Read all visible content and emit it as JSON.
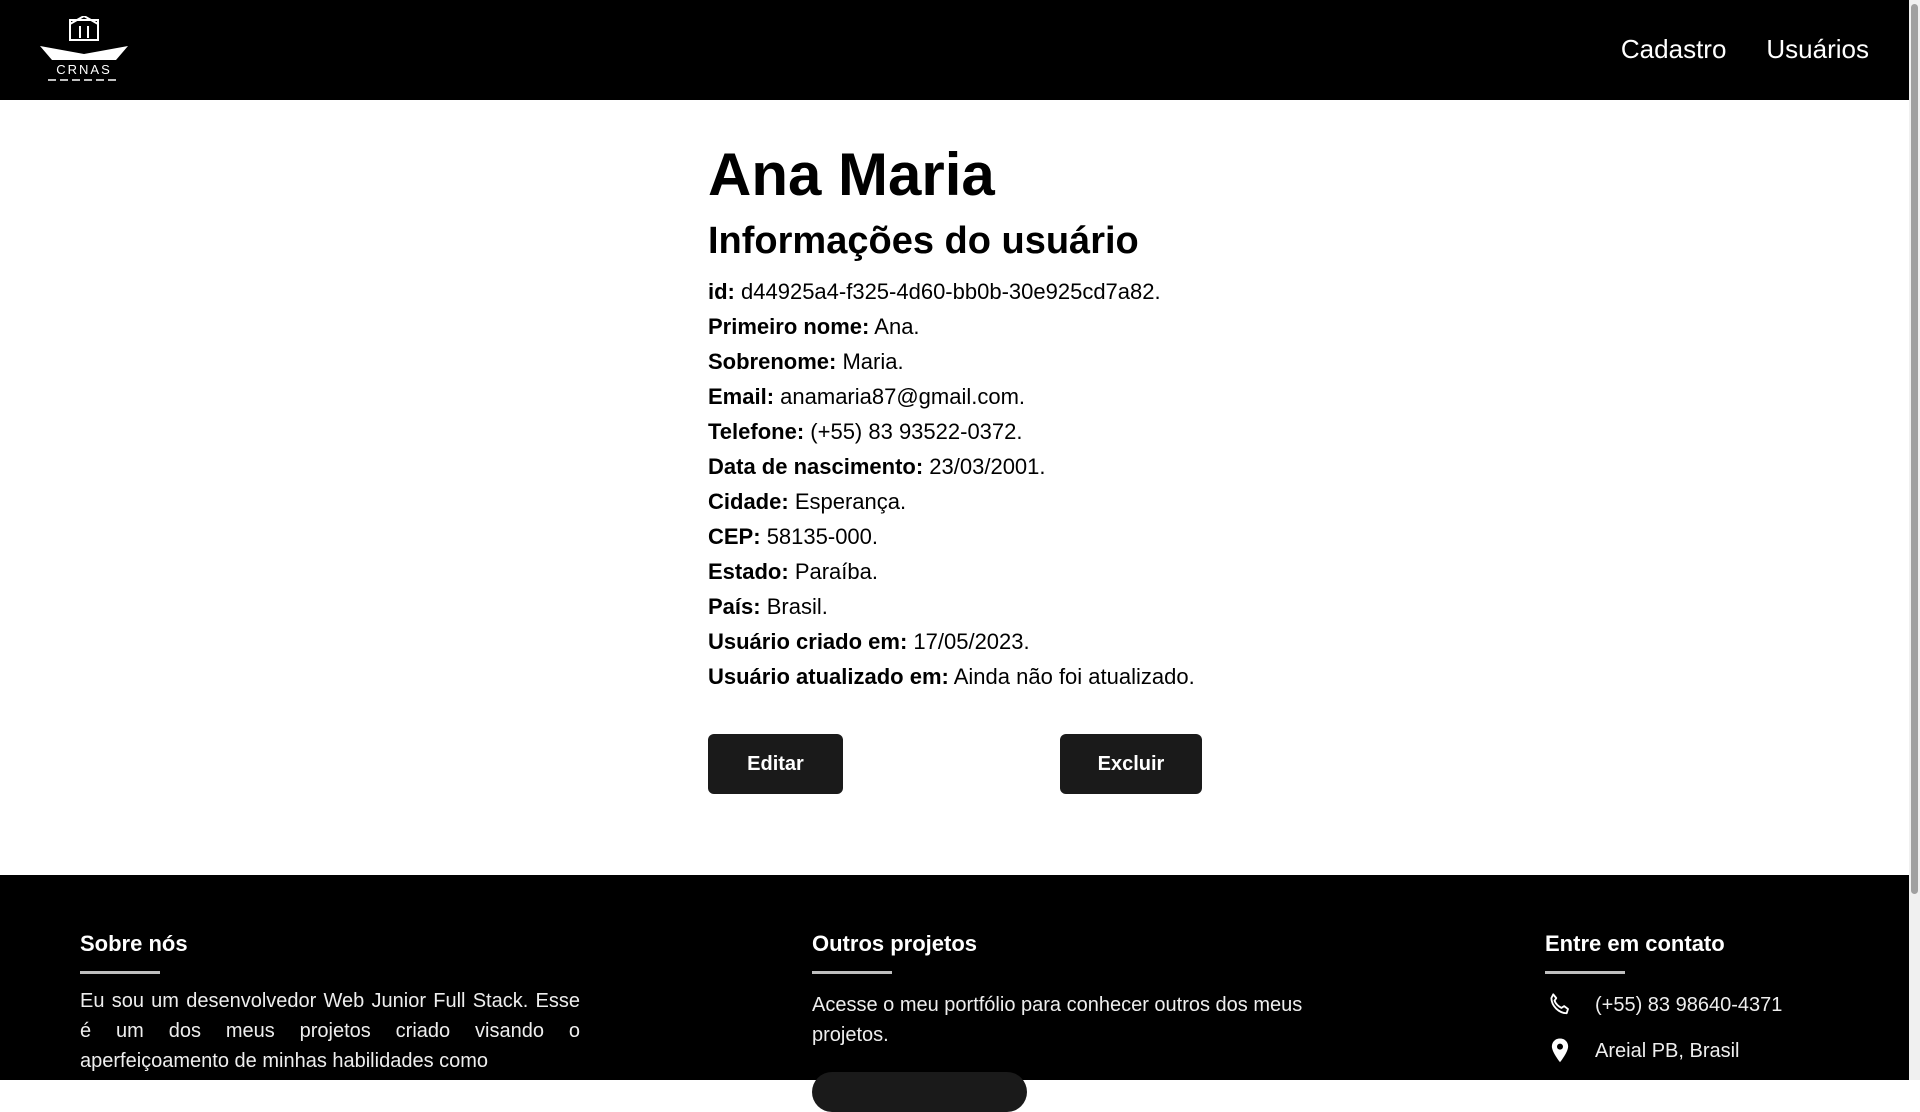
{
  "header": {
    "logo_text": "CRNAS",
    "nav": [
      {
        "label": "Cadastro"
      },
      {
        "label": "Usuários"
      }
    ]
  },
  "user": {
    "name": "Ana Maria",
    "section_title": "Informações do usuário",
    "fields": [
      {
        "label": "id:",
        "value": "d44925a4-f325-4d60-bb0b-30e925cd7a82."
      },
      {
        "label": "Primeiro nome:",
        "value": "Ana."
      },
      {
        "label": "Sobrenome:",
        "value": "Maria."
      },
      {
        "label": "Email:",
        "value": "anamaria87@gmail.com."
      },
      {
        "label": "Telefone:",
        "value": "(+55) 83 93522-0372."
      },
      {
        "label": "Data de nascimento:",
        "value": "23/03/2001."
      },
      {
        "label": "Cidade:",
        "value": "Esperança."
      },
      {
        "label": "CEP:",
        "value": "58135-000."
      },
      {
        "label": "Estado:",
        "value": "Paraíba."
      },
      {
        "label": "País:",
        "value": "Brasil."
      },
      {
        "label": "Usuário criado em:",
        "value": "17/05/2023."
      },
      {
        "label": "Usuário atualizado em:",
        "value": "Ainda não foi atualizado."
      }
    ],
    "edit_label": "Editar",
    "delete_label": "Excluir"
  },
  "footer": {
    "about": {
      "title": "Sobre nós",
      "text": "Eu sou um desenvolvedor Web Junior Full Stack. Esse é um dos meus projetos criado visando o aperfeiçoamento de minhas habilidades como"
    },
    "projects": {
      "title": "Outros projetos",
      "text": "Acesse o meu portfólio para conhecer outros dos meus projetos."
    },
    "contact": {
      "title": "Entre em contato",
      "phone": "(+55) 83 98640-4371",
      "location": "Areial PB, Brasil"
    }
  }
}
